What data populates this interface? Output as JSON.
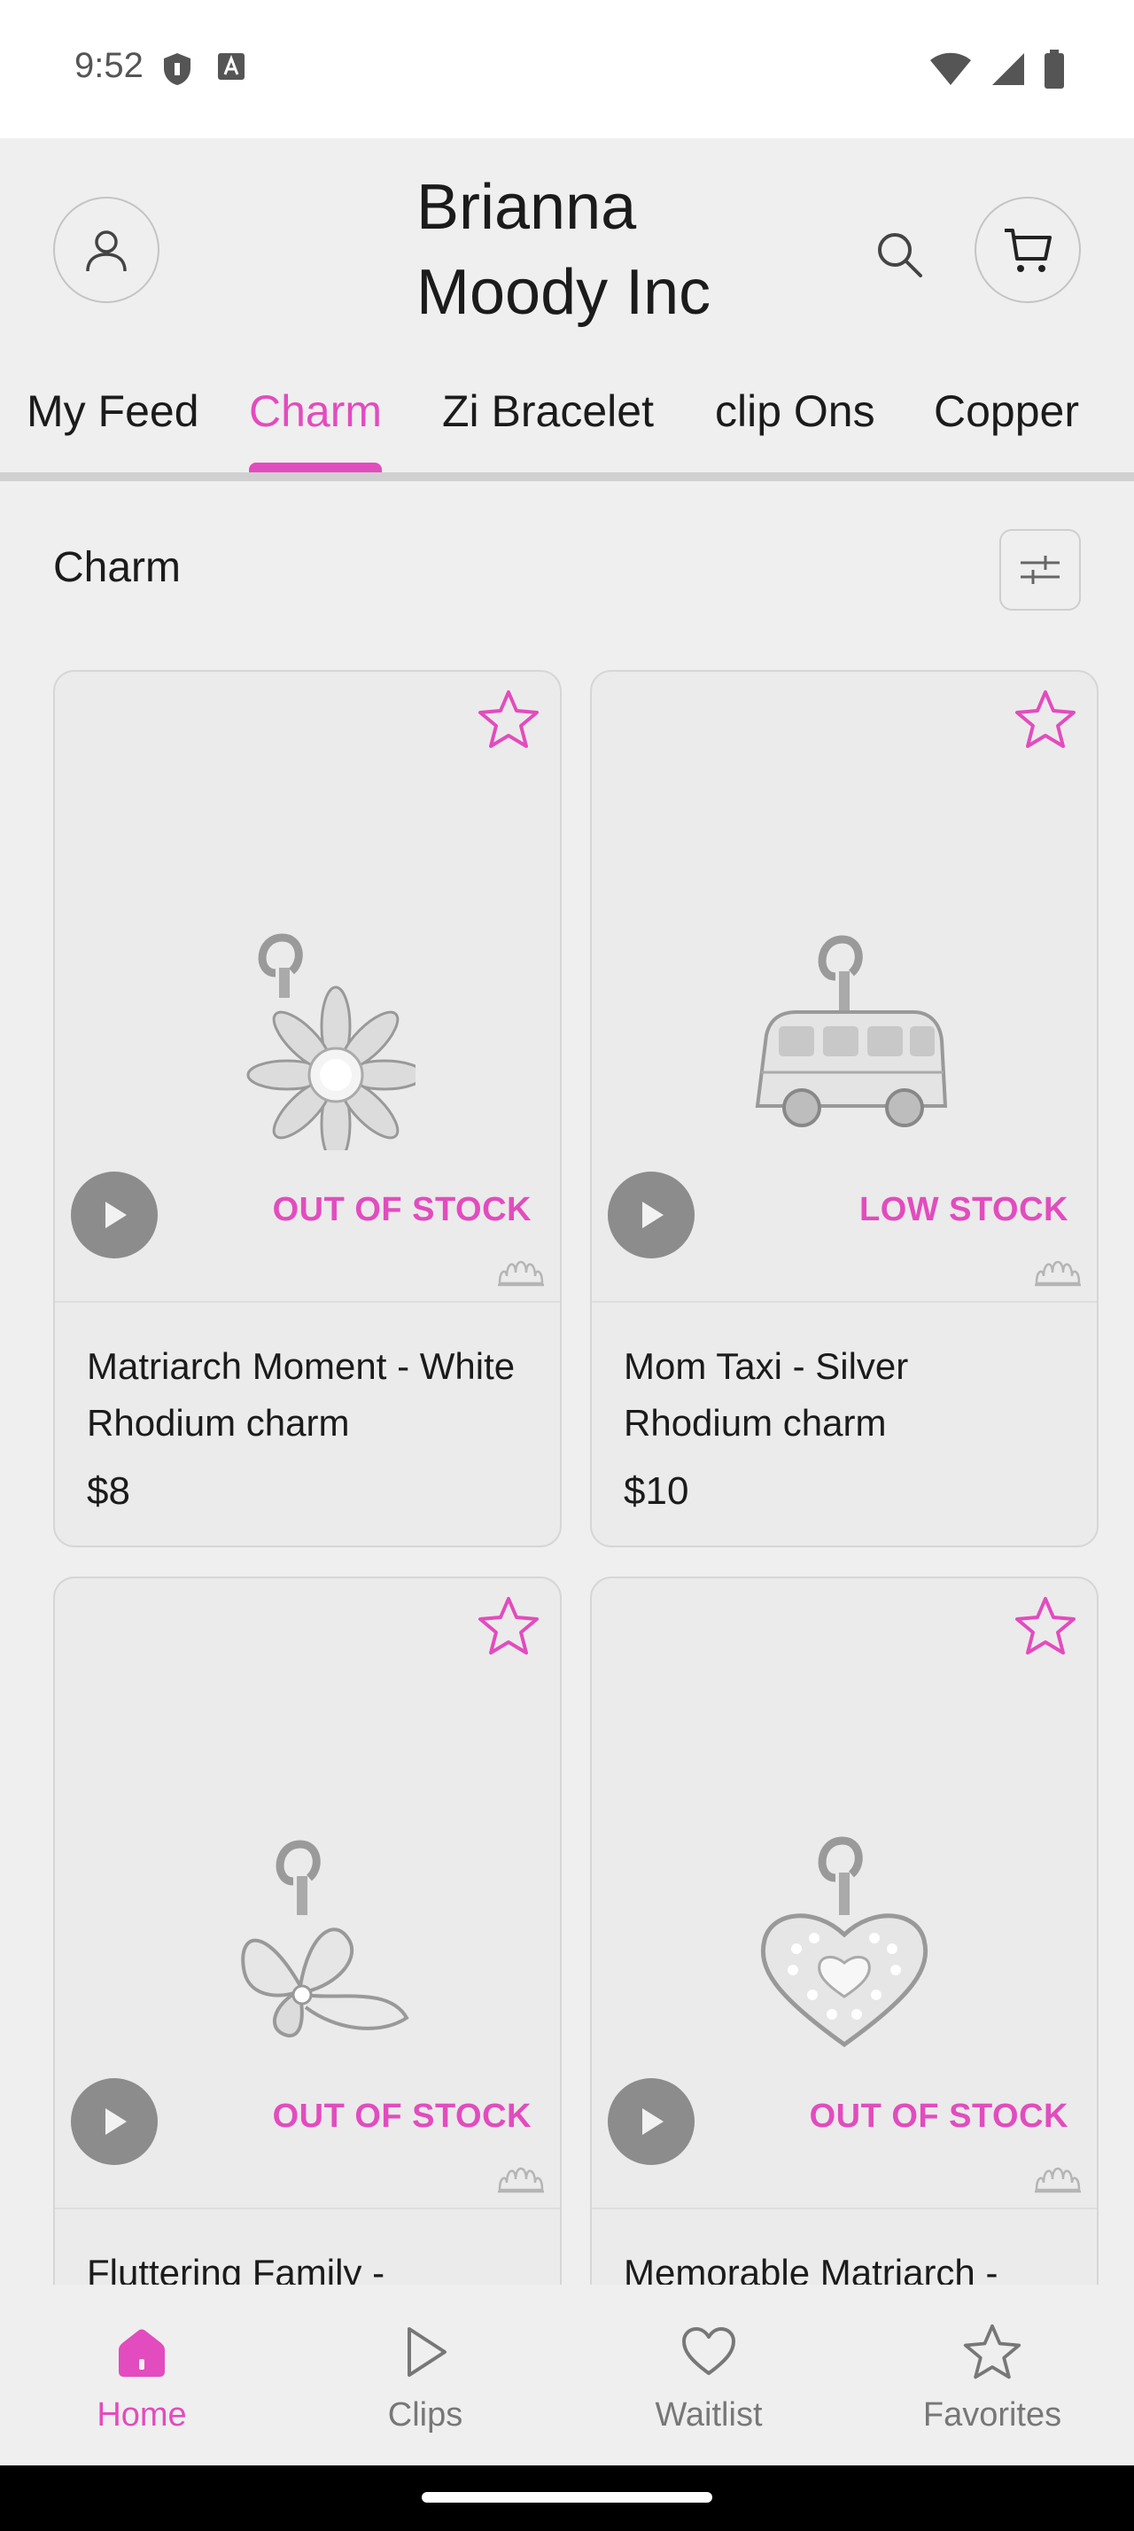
{
  "status_bar": {
    "time": "9:52"
  },
  "header": {
    "store_name": "Brianna Moody Inc",
    "account_icon": "person-icon",
    "search_icon": "search-icon",
    "cart_icon": "cart-icon"
  },
  "tabs": [
    {
      "label": "My Feed",
      "active": false
    },
    {
      "label": "Charm",
      "active": true
    },
    {
      "label": "Zi Bracelet",
      "active": false
    },
    {
      "label": "clip Ons",
      "active": false
    },
    {
      "label": "Copper",
      "active": false
    }
  ],
  "section": {
    "title": "Charm",
    "filter_icon": "sliders-icon"
  },
  "products": [
    {
      "name": "Matriarch Moment - White Rhodium charm",
      "price": "$8",
      "stock": "OUT OF STOCK",
      "image": "daisy-charm"
    },
    {
      "name": "Mom Taxi - Silver Rhodium charm",
      "price": "$10",
      "stock": "LOW STOCK",
      "image": "bus-charm"
    },
    {
      "name": "Fluttering Family -",
      "price": "",
      "stock": "OUT OF STOCK",
      "image": "butterfly-charm"
    },
    {
      "name": "Memorable Matriarch -",
      "price": "",
      "stock": "OUT OF STOCK",
      "image": "heart-charm"
    }
  ],
  "bottom_nav": [
    {
      "label": "Home",
      "icon": "home-icon",
      "active": true
    },
    {
      "label": "Clips",
      "icon": "play-icon",
      "active": false
    },
    {
      "label": "Waitlist",
      "icon": "heart-icon",
      "active": false
    },
    {
      "label": "Favorites",
      "icon": "star-icon",
      "active": false
    }
  ],
  "colors": {
    "accent": "#e24cbe",
    "background": "#efefef",
    "text": "#1b1b1b"
  }
}
